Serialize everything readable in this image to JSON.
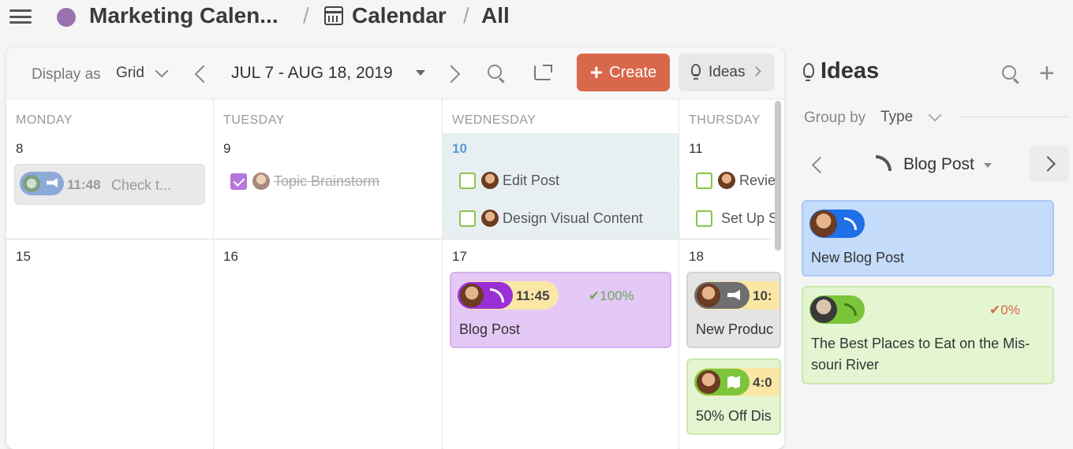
{
  "breadcrumb": {
    "project": "Marketing Calen...",
    "section": "Calendar",
    "view": "All",
    "separator": "/"
  },
  "toolbar": {
    "display_as_label": "Display as",
    "display_as_value": "Grid",
    "date_range": "JUL 7 - AUG 18, 2019",
    "create_label": "Create",
    "ideas_label": "Ideas"
  },
  "calendar": {
    "day_names": [
      "MONDAY",
      "TUESDAY",
      "WEDNESDAY",
      "THURSDAY"
    ],
    "week1_days": [
      "8",
      "9",
      "10",
      "11"
    ],
    "week2_days": [
      "15",
      "16",
      "17",
      "18"
    ],
    "today": "10",
    "events": {
      "mon8": {
        "time": "11:48",
        "title": "Check t..."
      },
      "tue9": {
        "title": "Topic Brainstorm"
      },
      "wed10_a": {
        "title": "Edit Post"
      },
      "wed10_b": {
        "title": "Design Visual Content"
      },
      "thu11_a": {
        "title": "Revie"
      },
      "thu11_b": {
        "title": "Set Up S"
      },
      "wed17": {
        "time": "11:45",
        "progress": "100%",
        "title": "Blog Post"
      },
      "thu18_a": {
        "time": "10:",
        "title": "New Produc"
      },
      "thu18_b": {
        "time": "4:0",
        "title": "50% Off Dis"
      }
    }
  },
  "ideas": {
    "title": "Ideas",
    "group_by_label": "Group by",
    "group_by_value": "Type",
    "type_filter": "Blog Post",
    "cards": [
      {
        "title": "New Blog Post",
        "color": "#c4dbfa"
      },
      {
        "title_line1": "The Best Places to Eat on the Mis-",
        "title_line2": "souri River",
        "progress": "0%",
        "color": "#e4f5d2"
      }
    ]
  },
  "colors": {
    "create_button": "#d9684b",
    "today_background": "#e8eff3",
    "blog_card": "#e4c8f5",
    "project_dot": "#9b72b0"
  }
}
